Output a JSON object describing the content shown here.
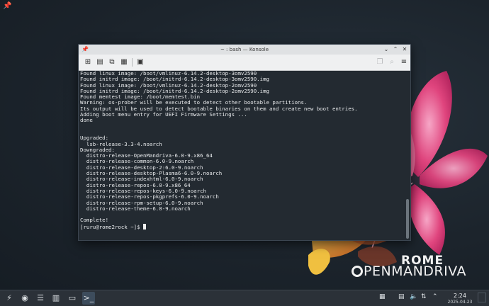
{
  "window": {
    "title": "~ : bash — Konsole",
    "titlebar_icons": [
      "pin-icon",
      "chevron-down-icon",
      "chevron-up-icon",
      "close-icon"
    ]
  },
  "toolbar": {
    "left_icons": [
      "new-tab-icon",
      "split-view-icon",
      "copy-icon",
      "paste-icon",
      "find-icon"
    ],
    "right_icons": [
      "bookmark-icon",
      "zoom-icon",
      "hamburger-menu-icon"
    ]
  },
  "terminal": {
    "lines": [
      "Found linux image: /boot/vmlinuz-6.14.2-desktop-3omv2590",
      "Found initrd image: /boot/initrd-6.14.2-desktop-3omv2590.img",
      "Found linux image: /boot/vmlinuz-6.14.2-desktop-2omv2590",
      "Found initrd image: /boot/initrd-6.14.2-desktop-2omv2590.img",
      "Found memtest image: /boot/memtest.bin",
      "Warning: os-prober will be executed to detect other bootable partitions.",
      "Its output will be used to detect bootable binaries on them and create new boot entries.",
      "Adding boot menu entry for UEFI Firmware Settings ...",
      "done",
      "",
      "",
      "Upgraded:",
      "  lsb-release-3.3-4.noarch",
      "Downgraded:",
      "  distro-release-OpenMandriva-6.0-9.x86_64",
      "  distro-release-common-6.0-9.noarch",
      "  distro-release-desktop-2:6.0-9.noarch",
      "  distro-release-desktop-Plasma6-6.0-9.noarch",
      "  distro-release-indexhtml-6.0-9.noarch",
      "  distro-release-repos-6.0-9.x86_64",
      "  distro-release-repos-keys-6.0-9.noarch",
      "  distro-release-repos-pkgprefs-6.0-9.noarch",
      "  distro-release-rpm-setup-6.0-9.noarch",
      "  distro-release-theme-6.0-9.noarch",
      "",
      "Complete!"
    ],
    "prompt": "[ruru@rome2rock ~]$ ",
    "scroll_position": 0.76
  },
  "branding": {
    "line1": "ROME",
    "line2": "PENMANDRIVA"
  },
  "taskbar": {
    "launcher_icon": "app-launcher-icon",
    "tasks": [
      "chromium-icon",
      "system-settings-icon",
      "discover-store-icon",
      "file-manager-icon",
      "konsole-icon"
    ],
    "tray_icons": [
      "pager-icon",
      "clipboard-icon",
      "volume-icon",
      "network-icon",
      "expand-tray-icon"
    ],
    "clock": {
      "time": "2:24",
      "date": "2025-04-23"
    }
  },
  "colors": {
    "terminal_bg": "#232a31",
    "terminal_fg": "#e8eaec",
    "titlebar": "#dfe1e3",
    "taskbar": "#2b3138"
  }
}
